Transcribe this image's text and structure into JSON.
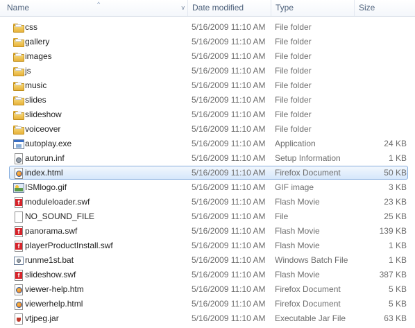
{
  "header": {
    "name": "Name",
    "date_modified": "Date modified",
    "type": "Type",
    "size": "Size",
    "sort_indicator": "^",
    "dropdown": "v"
  },
  "files": [
    {
      "name": "css",
      "date": "5/16/2009 11:10 AM",
      "type": "File folder",
      "size": "",
      "icon": "folder-icon"
    },
    {
      "name": "gallery",
      "date": "5/16/2009 11:10 AM",
      "type": "File folder",
      "size": "",
      "icon": "folder-icon"
    },
    {
      "name": "images",
      "date": "5/16/2009 11:10 AM",
      "type": "File folder",
      "size": "",
      "icon": "folder-icon"
    },
    {
      "name": "js",
      "date": "5/16/2009 11:10 AM",
      "type": "File folder",
      "size": "",
      "icon": "folder-icon"
    },
    {
      "name": "music",
      "date": "5/16/2009 11:10 AM",
      "type": "File folder",
      "size": "",
      "icon": "folder-icon"
    },
    {
      "name": "slides",
      "date": "5/16/2009 11:10 AM",
      "type": "File folder",
      "size": "",
      "icon": "folder-icon"
    },
    {
      "name": "slideshow",
      "date": "5/16/2009 11:10 AM",
      "type": "File folder",
      "size": "",
      "icon": "folder-icon"
    },
    {
      "name": "voiceover",
      "date": "5/16/2009 11:10 AM",
      "type": "File folder",
      "size": "",
      "icon": "folder-icon"
    },
    {
      "name": "autoplay.exe",
      "date": "5/16/2009 11:10 AM",
      "type": "Application",
      "size": "24 KB",
      "icon": "application-icon"
    },
    {
      "name": "autorun.inf",
      "date": "5/16/2009 11:10 AM",
      "type": "Setup Information",
      "size": "1 KB",
      "icon": "setup-information-icon"
    },
    {
      "name": "index.html",
      "date": "5/16/2009 11:10 AM",
      "type": "Firefox Document",
      "size": "50 KB",
      "icon": "firefox-document-icon",
      "selected": true
    },
    {
      "name": "ISMlogo.gif",
      "date": "5/16/2009 11:10 AM",
      "type": "GIF image",
      "size": "3 KB",
      "icon": "gif-image-icon"
    },
    {
      "name": "moduleloader.swf",
      "date": "5/16/2009 11:10 AM",
      "type": "Flash Movie",
      "size": "23 KB",
      "icon": "flash-movie-icon"
    },
    {
      "name": "NO_SOUND_FILE",
      "date": "5/16/2009 11:10 AM",
      "type": "File",
      "size": "25 KB",
      "icon": "file-icon"
    },
    {
      "name": "panorama.swf",
      "date": "5/16/2009 11:10 AM",
      "type": "Flash Movie",
      "size": "139 KB",
      "icon": "flash-movie-icon"
    },
    {
      "name": "playerProductInstall.swf",
      "date": "5/16/2009 11:10 AM",
      "type": "Flash Movie",
      "size": "1 KB",
      "icon": "flash-movie-icon"
    },
    {
      "name": "runme1st.bat",
      "date": "5/16/2009 11:10 AM",
      "type": "Windows Batch File",
      "size": "1 KB",
      "icon": "batch-file-icon"
    },
    {
      "name": "slideshow.swf",
      "date": "5/16/2009 11:10 AM",
      "type": "Flash Movie",
      "size": "387 KB",
      "icon": "flash-movie-icon"
    },
    {
      "name": "viewer-help.htm",
      "date": "5/16/2009 11:10 AM",
      "type": "Firefox Document",
      "size": "5 KB",
      "icon": "firefox-document-icon"
    },
    {
      "name": "viewerhelp.html",
      "date": "5/16/2009 11:10 AM",
      "type": "Firefox Document",
      "size": "5 KB",
      "icon": "firefox-document-icon"
    },
    {
      "name": "vtjpeg.jar",
      "date": "5/16/2009 11:10 AM",
      "type": "Executable Jar File",
      "size": "63 KB",
      "icon": "jar-file-icon"
    }
  ]
}
